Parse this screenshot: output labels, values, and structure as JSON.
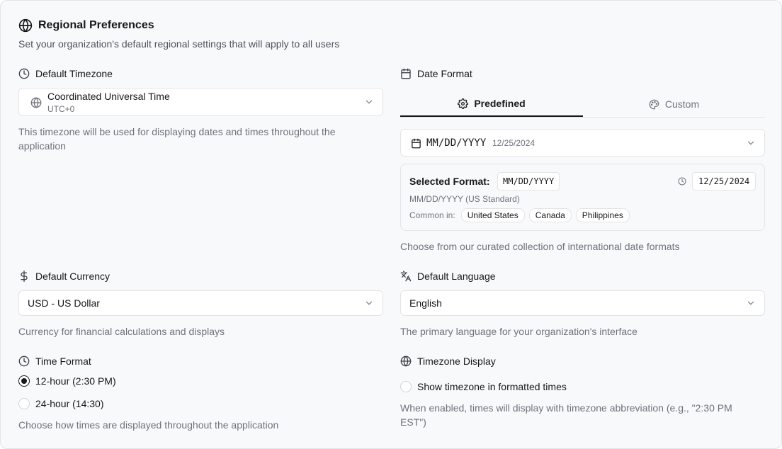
{
  "header": {
    "title": "Regional Preferences",
    "subtitle": "Set your organization's default regional settings that will apply to all users"
  },
  "timezone": {
    "label": "Default Timezone",
    "value": "Coordinated Universal Time",
    "offset": "UTC+0",
    "help": "This timezone will be used for displaying dates and times throughout the application"
  },
  "date_format": {
    "label": "Date Format",
    "tabs": [
      {
        "label": "Predefined",
        "active": true
      },
      {
        "label": "Custom",
        "active": false
      }
    ],
    "select_value": "MM/DD/YYYY",
    "select_example": "12/25/2024",
    "selected_label": "Selected Format:",
    "selected_format": "MM/DD/YYYY",
    "preview": "12/25/2024",
    "description": "MM/DD/YYYY (US Standard)",
    "common_in_label": "Common in:",
    "common_in": [
      "United States",
      "Canada",
      "Philippines"
    ],
    "help": "Choose from our curated collection of international date formats"
  },
  "currency": {
    "label": "Default Currency",
    "value": "USD - US Dollar",
    "help": "Currency for financial calculations and displays"
  },
  "language": {
    "label": "Default Language",
    "value": "English",
    "help": "The primary language for your organization's interface"
  },
  "time_format": {
    "label": "Time Format",
    "options": [
      {
        "label": "12-hour (2:30 PM)",
        "checked": true
      },
      {
        "label": "24-hour (14:30)",
        "checked": false
      }
    ],
    "help": "Choose how times are displayed throughout the application"
  },
  "timezone_display": {
    "label": "Timezone Display",
    "option_label": "Show timezone in formatted times",
    "checked": false,
    "help": "When enabled, times will display with timezone abbreviation (e.g., \"2:30 PM EST\")"
  },
  "colors": {
    "accent": "#18181b",
    "muted_text": "#71717a",
    "border": "#e4e4e7",
    "background": "#f8f9fb"
  }
}
